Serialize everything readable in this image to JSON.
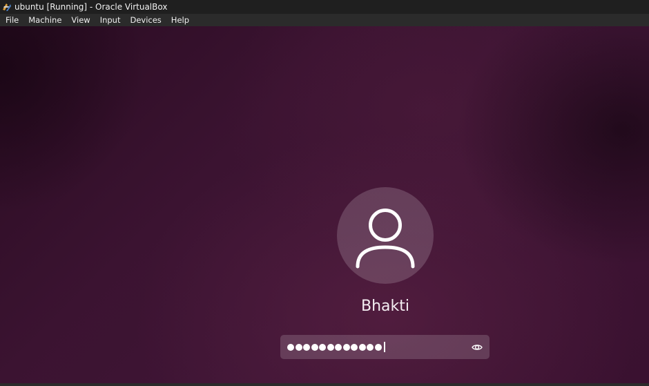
{
  "window": {
    "title": "ubuntu [Running] - Oracle VirtualBox",
    "icon": "virtualbox-icon"
  },
  "menubar": {
    "items": [
      {
        "label": "File"
      },
      {
        "label": "Machine"
      },
      {
        "label": "View"
      },
      {
        "label": "Input"
      },
      {
        "label": "Devices"
      },
      {
        "label": "Help"
      }
    ]
  },
  "login": {
    "avatar_icon": "user-icon",
    "username": "Bhakti",
    "password_dot_count": 12,
    "show_password_icon": "eye-icon"
  },
  "colors": {
    "background": "#3b1331",
    "text": "#f4eef2"
  }
}
